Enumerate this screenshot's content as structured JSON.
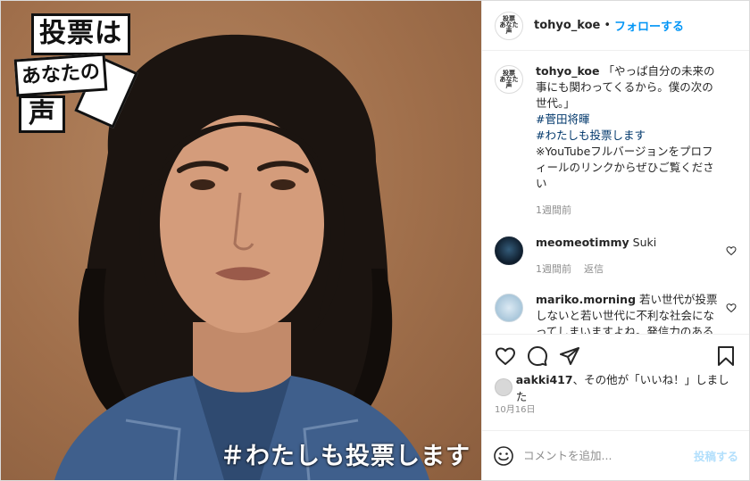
{
  "media": {
    "logo": {
      "line1": "投票は",
      "line2": "あなたの",
      "line3": "声"
    },
    "caption_overlay": "＃わたしも投票します"
  },
  "header": {
    "username": "tohyo_koe",
    "separator": "•",
    "follow_label": "フォローする",
    "avatar_icon": "tohyo-koe-logo-icon"
  },
  "caption": {
    "username": "tohyo_koe",
    "text": "「やっぱ自分の未来の事にも関わってくるから。僕の次の世代。」",
    "hashtag1": "#菅田将暉",
    "hashtag2": "#わたしも投票します",
    "note": "※YouTubeフルバージョンをプロフィールのリンクからぜひご覧ください",
    "time": "1週間前"
  },
  "comments": [
    {
      "username": "meomeotimmy",
      "text": "Suki",
      "time": "1週間前",
      "reply": "返信"
    },
    {
      "username": "mariko.morning",
      "text": "若い世代が投票しないと若い世代に不利な社会になってしまいますよね。発信力のある皆様で、声を上げて頂いてありがとうございます！感動しました！もちろん投票します！"
    }
  ],
  "actions": {
    "like_icon": "heart-icon",
    "comment_icon": "comment-icon",
    "share_icon": "paper-plane-icon",
    "save_icon": "bookmark-icon"
  },
  "likes": {
    "user": "aakki417",
    "suffix": "、その他が「いいね！」しました"
  },
  "date": "10月16日",
  "add_comment": {
    "placeholder": "コメントを追加...",
    "post_label": "投稿する",
    "emoji_icon": "smiley-icon"
  },
  "colors": {
    "accent": "#0095f6",
    "hashtag": "#00376b",
    "post_disabled": "#b2dffc",
    "muted": "#8e8e8e",
    "photo_background": "#a0714d"
  }
}
